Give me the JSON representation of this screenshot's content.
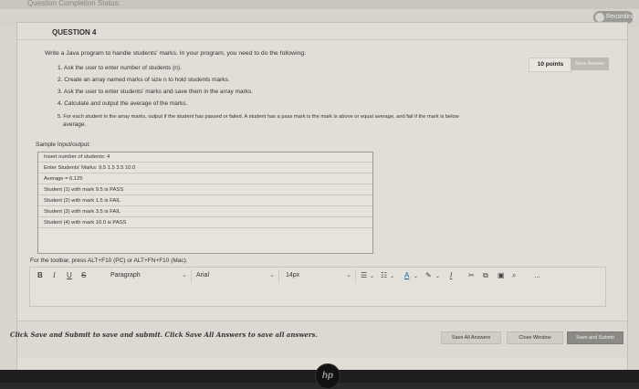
{
  "window": {
    "title": "Question Completion Status:",
    "recording_label": "Recording"
  },
  "question": {
    "title": "QUESTION 4",
    "prompt": "Write a Java program to handle students' marks. In your program, you need to do the following:",
    "steps": [
      "1. Ask the user to enter number of students (n).",
      "2. Create an array named marks of size n to hold students marks.",
      "3. Ask the user to enter students' marks and save them in the array marks.",
      "4. Calculate and output the average of the marks.",
      "5. For each student in the array marks, output if the student has passed or failed. A student has a pass mark is the mark is above or equal average, and fail if the mark is below",
      "average."
    ],
    "points": "10 points",
    "save_answer": "Save Answer",
    "sample_label": "Sample Input/output:",
    "sample_lines": [
      "Insert number of students: 4",
      "Enter Students' Marks: 9.5   1.5   3.5   10.0",
      "Average = 6.125",
      "Student (1) with mark 9.5 is PASS",
      "Student (2) with mark 1.5 is FAIL",
      "Student (3) with mark 3.5 is FAIL",
      "Student (4) with mark 10.0 is PASS"
    ],
    "toolbar_hint": "For the toolbar, press ALT+F10 (PC) or ALT+FN+F10 (Mac)."
  },
  "editor": {
    "bold": "B",
    "italic": "I",
    "underline": "U",
    "strike": "S",
    "paragraph": "Paragraph",
    "font": "Arial",
    "size": "14px",
    "more": "..."
  },
  "footer": {
    "message": "Click Save and Submit to save and submit. Click Save All Answers to save all answers.",
    "save_all": "Save All Answers",
    "close_window": "Close Window",
    "save_submit": "Save and Submit"
  },
  "device": {
    "logo": "hp"
  }
}
